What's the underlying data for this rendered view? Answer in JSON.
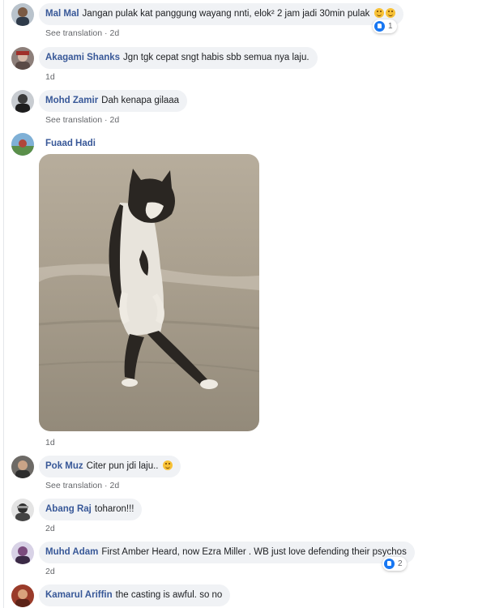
{
  "comments": [
    {
      "author": "Mal Mal",
      "text": "Jangan pulak kat panggung wayang nnti, elok² 2 jam jadi 30min pulak",
      "see_translation": "See translation",
      "sep": "·",
      "time": "2d",
      "reaction_count": "1"
    },
    {
      "author": "Akagami Shanks",
      "text": "Jgn tgk cepat sngt habis sbb semua nya laju.",
      "time": "1d"
    },
    {
      "author": "Mohd Zamir",
      "text": "Dah kenapa gilaaa",
      "see_translation": "See translation",
      "sep": "·",
      "time": "2d"
    },
    {
      "author": "Fuaad Hadi",
      "time": "1d"
    },
    {
      "author": "Pok Muz",
      "text": "Citer pun jdi laju..",
      "see_translation": "See translation",
      "sep": "·",
      "time": "2d"
    },
    {
      "author": "Abang Raj",
      "text": "toharon!!!",
      "time": "2d"
    },
    {
      "author": "Muhd Adam",
      "text": "First Amber Heard, now Ezra Miller . WB just love defending their psychos",
      "time": "2d",
      "reaction_count": "2"
    },
    {
      "author": "Kamarul Ariffin",
      "text": "the casting is awful. so no"
    }
  ],
  "colors": {
    "author": "#385898",
    "bubble": "#f0f2f5",
    "meta": "#65676b",
    "like": "#1877f2"
  },
  "icons": {
    "like": "like-icon",
    "laugh": "laughing-emoji-icon"
  }
}
